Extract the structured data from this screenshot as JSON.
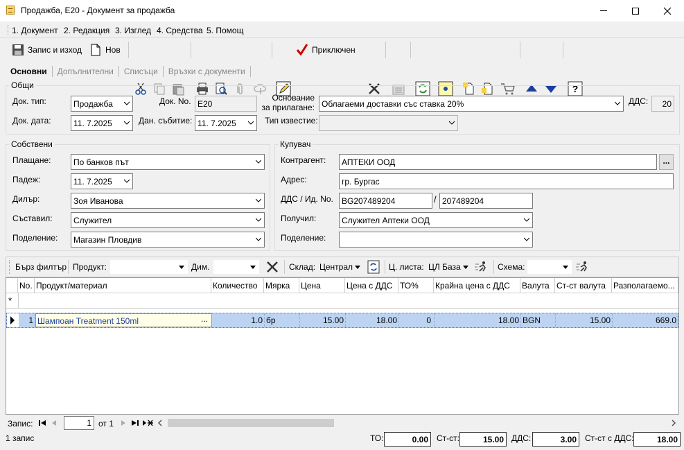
{
  "window": {
    "title": "Продажба, E20 - Документ за продажба"
  },
  "menu": [
    "1. Документ",
    "2. Редакция",
    "3. Изглед",
    "4. Средства",
    "5. Помощ"
  ],
  "toolbar": {
    "save_exit": "Запис и изход",
    "new": "Нов",
    "completed": "Приключен"
  },
  "tabs": [
    "Основни",
    "Допълнителни",
    "Списъци",
    "Връзки с документи"
  ],
  "general": {
    "title": "Общи",
    "doc_type_label": "Док. тип:",
    "doc_type": "Продажба",
    "doc_no_label": "Док. No.",
    "doc_no": "E20",
    "basis_label_1": "Основание",
    "basis_label_2": "за прилагане:",
    "basis": "Облагаеми доставки със ставка 20%",
    "vat_label": "ДДС:",
    "vat": "20",
    "doc_date_label": "Док. дата:",
    "doc_date": "11.  7.2025",
    "tax_date_label": "Дан. събитие:",
    "tax_date": "11.  7.2025",
    "notice_label": "Тип известие:",
    "notice": ""
  },
  "own": {
    "title": "Собствени",
    "payment_label": "Плащане:",
    "payment": "По банков път",
    "due_label": "Падеж:",
    "due": "11.  7.2025",
    "dealer_label": "Дилър:",
    "dealer": "Зоя Иванова",
    "author_label": "Съставил:",
    "author": "Служител",
    "dept_label": "Поделение:",
    "dept": "Магазин Пловдив"
  },
  "buyer": {
    "title": "Купувач",
    "partner_label": "Контрагент:",
    "partner": "АПТЕКИ ООД",
    "address_label": "Адрес:",
    "address": "гр. Бургас",
    "vat_label": "ДДС / Ид. No.",
    "vat_no": "BG207489204",
    "id_no": "207489204",
    "receiver_label": "Получил:",
    "receiver": "Служител Аптеки ООД",
    "dept_label": "Поделение:",
    "dept": "",
    "more_btn": "..."
  },
  "filter": {
    "quick": "Бърз филтър",
    "product_label": "Продукт:",
    "dim_label": "Дим.",
    "store_label": "Склад:",
    "store": "Централ",
    "pricelist_label": "Ц. листа:",
    "pricelist": "ЦЛ База",
    "scheme_label": "Схема:"
  },
  "grid": {
    "headers": [
      "No.",
      "Продукт/материал",
      "Количество",
      "Мярка",
      "Цена",
      "Цена с ДДС",
      "ТО%",
      "Крайна цена с ДДС",
      "Валута",
      "Ст-ст валута",
      "Разполагаемо..."
    ],
    "new_row_mark": "*",
    "rows": [
      {
        "no": "1",
        "product": "Шампоан Treatment 150ml",
        "qty": "1.0",
        "unit": "бр",
        "price": "15.00",
        "price_vat": "18.00",
        "to": "0",
        "final": "18.00",
        "currency": "BGN",
        "value_cur": "15.00",
        "avail": "669.0"
      }
    ]
  },
  "nav": {
    "record_label": "Запис:",
    "record": "1",
    "of": "от 1"
  },
  "status": {
    "count": "1 запис",
    "to_label": "ТО:",
    "to": "0.00",
    "val_label": "Ст-ст:",
    "val": "15.00",
    "vat_label": "ДДС:",
    "vat": "3.00",
    "total_label": "Ст-ст с ДДС:",
    "total": "18.00"
  },
  "colors": {
    "selected_row": "#bcd4f2",
    "accent": "#0066cc",
    "check": "#cc0000"
  }
}
